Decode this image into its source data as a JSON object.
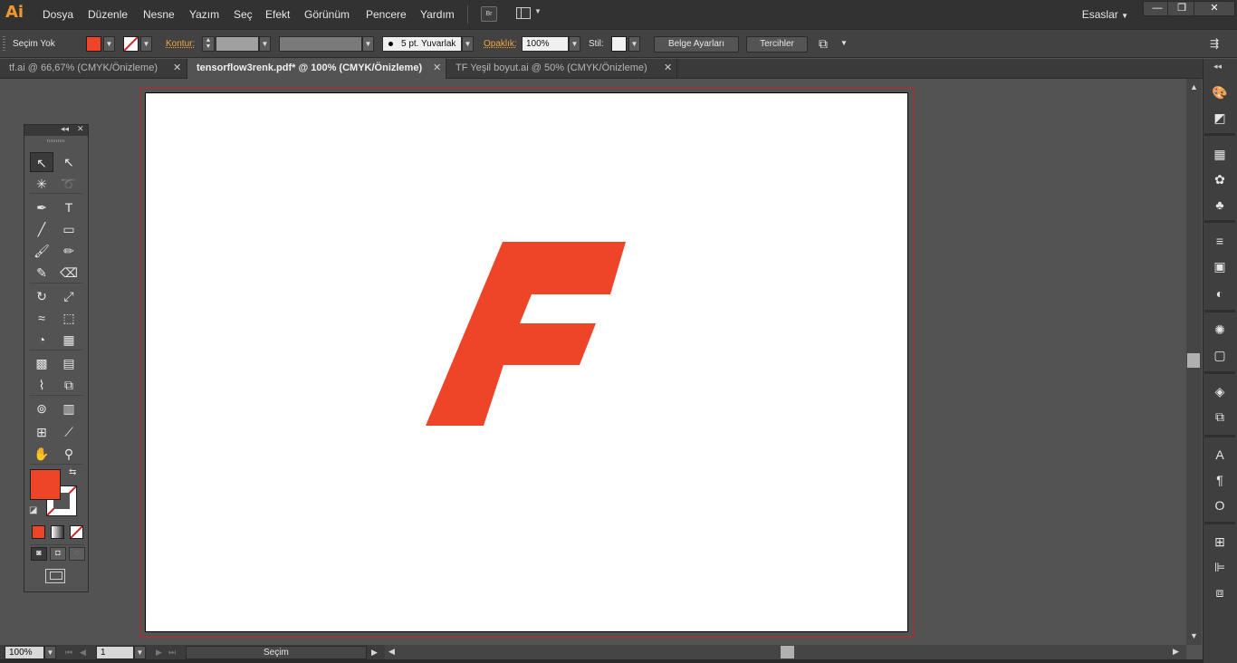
{
  "app": {
    "logo": "Ai",
    "brand_color": "#f29b2c"
  },
  "menu": {
    "items": [
      "Dosya",
      "Düzenle",
      "Nesne",
      "Yazım",
      "Seç",
      "Efekt",
      "Görünüm",
      "Pencere",
      "Yardım"
    ],
    "bridge_label": "Br",
    "workspace": "Esaslar"
  },
  "control": {
    "selection_status": "Seçim Yok",
    "fill_color": "#ee4528",
    "stroke_label": "Kontur:",
    "brush_label": "5 pt. Yuvarlak",
    "opacity_label": "Opaklık:",
    "opacity_value": "100%",
    "style_label": "Stil:",
    "doc_setup_button": "Belge Ayarları",
    "prefs_button": "Tercihler"
  },
  "tabs": [
    {
      "label": "tf.ai @ 66,67% (CMYK/Önizleme)",
      "active": false
    },
    {
      "label": "tensorflow3renk.pdf* @ 100% (CMYK/Önizleme)",
      "active": true
    },
    {
      "label": "TF Yeşil boyut.ai @ 50% (CMYK/Önizleme)",
      "active": false
    }
  ],
  "artwork": {
    "shape": "letter F logo",
    "color": "#ee4528"
  },
  "tools_panel": {
    "tools": [
      {
        "name": "selection-tool",
        "glyph": "↖"
      },
      {
        "name": "direct-selection-tool",
        "glyph": "↖"
      },
      {
        "name": "magic-wand-tool",
        "glyph": "✳"
      },
      {
        "name": "lasso-tool",
        "glyph": "➰"
      },
      {
        "name": "pen-tool",
        "glyph": "✒"
      },
      {
        "name": "type-tool",
        "glyph": "T"
      },
      {
        "name": "line-segment-tool",
        "glyph": "╱"
      },
      {
        "name": "rectangle-tool",
        "glyph": "▭"
      },
      {
        "name": "paintbrush-tool",
        "glyph": "🖌"
      },
      {
        "name": "pencil-tool",
        "glyph": "✏"
      },
      {
        "name": "blob-brush-tool",
        "glyph": "✎"
      },
      {
        "name": "eraser-tool",
        "glyph": "⌫"
      },
      {
        "name": "rotate-tool",
        "glyph": "↻"
      },
      {
        "name": "scale-tool",
        "glyph": "⤢"
      },
      {
        "name": "width-tool",
        "glyph": "≈"
      },
      {
        "name": "free-transform-tool",
        "glyph": "⬚"
      },
      {
        "name": "shape-builder-tool",
        "glyph": "◔"
      },
      {
        "name": "perspective-grid-tool",
        "glyph": "▦"
      },
      {
        "name": "mesh-tool",
        "glyph": "▩"
      },
      {
        "name": "gradient-tool",
        "glyph": "▤"
      },
      {
        "name": "eyedropper-tool",
        "glyph": "⌇"
      },
      {
        "name": "blend-tool",
        "glyph": "⧉"
      },
      {
        "name": "symbol-sprayer-tool",
        "glyph": "⊚"
      },
      {
        "name": "column-graph-tool",
        "glyph": "▥"
      },
      {
        "name": "artboard-tool",
        "glyph": "⊞"
      },
      {
        "name": "slice-tool",
        "glyph": "⟋"
      },
      {
        "name": "hand-tool",
        "glyph": "✋"
      },
      {
        "name": "zoom-tool",
        "glyph": "⚲"
      }
    ],
    "fill_color": "#ee4528",
    "stroke_color": "#ffffff"
  },
  "status": {
    "zoom": "100%",
    "artboard_number": "1",
    "tool_name": "Seçim"
  },
  "dock": {
    "icons": [
      "color-guide-icon",
      "color-icon",
      "swatches-icon",
      "brushes-icon",
      "symbols-icon",
      "stroke-icon",
      "gradient-icon",
      "transparency-icon",
      "appearance-icon",
      "graphic-styles-icon",
      "layers-icon",
      "artboards-icon",
      "character-icon",
      "paragraph-icon",
      "opentype-icon",
      "transform-icon",
      "align-icon",
      "pathfinder-icon"
    ],
    "glyphs": [
      "🎨",
      "◩",
      "▦",
      "✿",
      "♣",
      "≡",
      "▣",
      "◐",
      "✺",
      "▢",
      "◈",
      "⧉",
      "A",
      "¶",
      "O",
      "⊞",
      "⊫",
      "⧈"
    ]
  }
}
